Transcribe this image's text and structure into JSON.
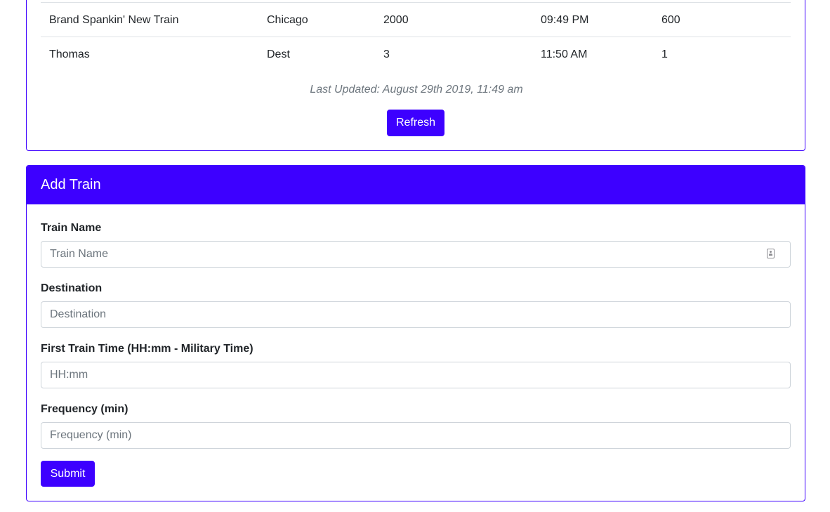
{
  "schedule": {
    "rows": [
      [
        "Brand Spankin' New Train",
        "Chicago",
        "2000",
        "09:49 PM",
        "600"
      ],
      [
        "Thomas",
        "Dest",
        "3",
        "11:50 AM",
        "1"
      ]
    ],
    "last_updated": "Last Updated: August 29th 2019, 11:49 am",
    "refresh_label": "Refresh"
  },
  "add_train": {
    "header": "Add Train",
    "fields": [
      {
        "label": "Train Name",
        "placeholder": "Train Name"
      },
      {
        "label": "Destination",
        "placeholder": "Destination"
      },
      {
        "label": "First Train Time (HH:mm - Military Time)",
        "placeholder": "HH:mm"
      },
      {
        "label": "Frequency (min)",
        "placeholder": "Frequency (min)"
      }
    ],
    "submit_label": "Submit"
  },
  "colors": {
    "accent": "#3d00ff",
    "muted_text": "#6c757d",
    "border": "#dee2e6"
  },
  "icons": {
    "train_name_field_icon": "contact-card-icon"
  }
}
